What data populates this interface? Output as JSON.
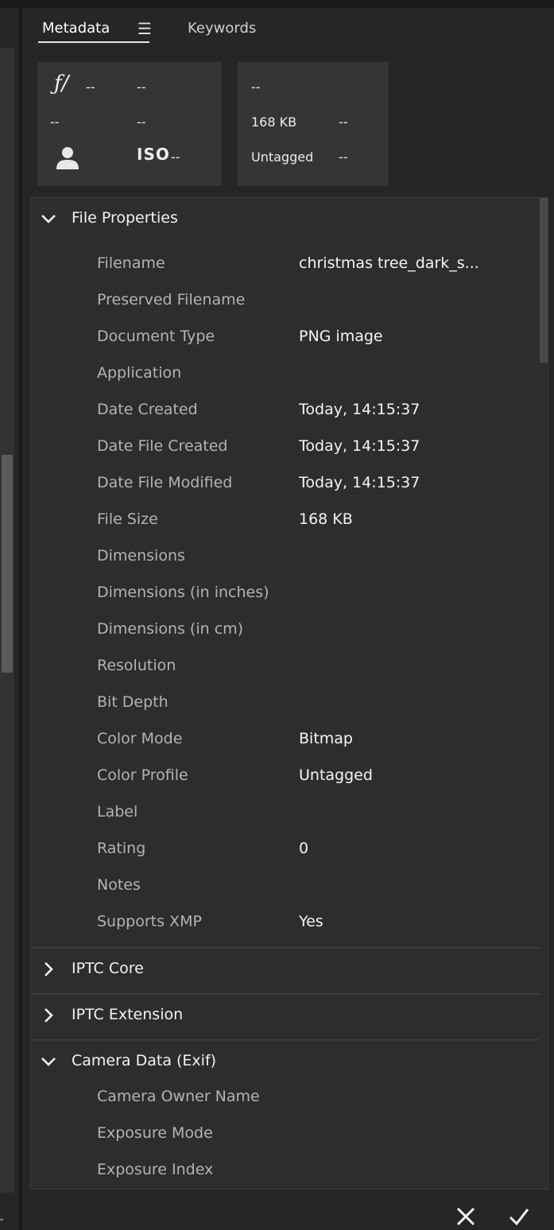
{
  "tabs": {
    "metadata": "Metadata",
    "keywords": "Keywords"
  },
  "icons": {
    "panel_menu": "menu-icon",
    "person": "person-icon",
    "chevron_down": "chevron-down-icon",
    "chevron_right": "chevron-right-icon",
    "cancel": "close-icon",
    "apply": "check-icon"
  },
  "summary_left": {
    "aperture_symbol": "ƒ/",
    "aperture_value": "--",
    "shutter": "--",
    "r2c1": "--",
    "r2c2": "--",
    "iso_label": "ISO",
    "iso_value": "--"
  },
  "summary_right": {
    "r1c1": "--",
    "size": "168 KB",
    "r2c2": "--",
    "profile": "Untagged",
    "r3c2": "--"
  },
  "sections": {
    "file_properties": {
      "title": "File Properties",
      "rows": [
        {
          "label": "Filename",
          "value": "christmas tree_dark_s..."
        },
        {
          "label": "Preserved Filename",
          "value": ""
        },
        {
          "label": "Document Type",
          "value": "PNG image"
        },
        {
          "label": "Application",
          "value": ""
        },
        {
          "label": "Date Created",
          "value": "Today, 14:15:37"
        },
        {
          "label": "Date File Created",
          "value": "Today, 14:15:37"
        },
        {
          "label": "Date File Modified",
          "value": "Today, 14:15:37"
        },
        {
          "label": "File Size",
          "value": "168 KB"
        },
        {
          "label": "Dimensions",
          "value": ""
        },
        {
          "label": "Dimensions (in inches)",
          "value": ""
        },
        {
          "label": "Dimensions (in cm)",
          "value": ""
        },
        {
          "label": "Resolution",
          "value": ""
        },
        {
          "label": "Bit Depth",
          "value": ""
        },
        {
          "label": "Color Mode",
          "value": "Bitmap"
        },
        {
          "label": "Color Profile",
          "value": "Untagged"
        },
        {
          "label": "Label",
          "value": ""
        },
        {
          "label": "Rating",
          "value": "0"
        },
        {
          "label": "Notes",
          "value": ""
        },
        {
          "label": "Supports XMP",
          "value": "Yes"
        }
      ]
    },
    "iptc_core": {
      "title": "IPTC Core"
    },
    "iptc_extension": {
      "title": "IPTC Extension"
    },
    "camera_data": {
      "title": "Camera Data (Exif)",
      "rows": [
        {
          "label": "Camera Owner Name",
          "value": ""
        },
        {
          "label": "Exposure Mode",
          "value": ""
        },
        {
          "label": "Exposure Index",
          "value": ""
        }
      ]
    }
  }
}
